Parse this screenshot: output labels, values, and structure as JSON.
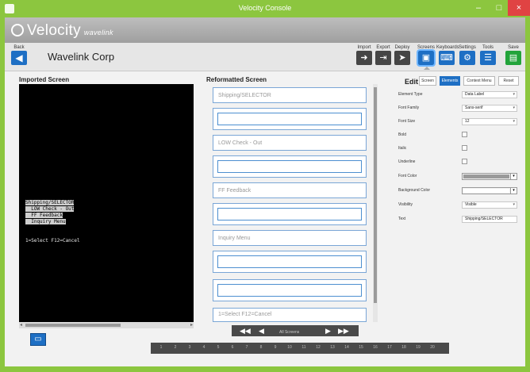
{
  "window": {
    "title": "Velocity Console",
    "controls": {
      "minimize": "–",
      "maximize": "□",
      "close": "×"
    }
  },
  "brand": {
    "name": "Velocity",
    "sub": "wavelink"
  },
  "toolbar": {
    "back_label": "Back",
    "company": "Wavelink Corp",
    "tools": [
      {
        "label": "Import",
        "icon": "import-icon",
        "style": "dark"
      },
      {
        "label": "Export",
        "icon": "export-icon",
        "style": "dark"
      },
      {
        "label": "Deploy",
        "icon": "deploy-icon",
        "style": "dark"
      },
      {
        "label": "Screens",
        "icon": "screens-icon",
        "style": "blue"
      },
      {
        "label": "Keyboards",
        "icon": "keyboard-icon",
        "style": "blue"
      },
      {
        "label": "Settings",
        "icon": "gear-icon",
        "style": "blue"
      },
      {
        "label": "Tools",
        "icon": "tools-icon",
        "style": "blue"
      },
      {
        "label": "Save",
        "icon": "save-icon",
        "style": "green"
      }
    ]
  },
  "imported": {
    "title": "Imported Screen",
    "lines": [
      "Shipping/SELECTOR",
      "  LOW Check - Out",
      "  FF Feedback",
      "  Inquiry Menu",
      "",
      "1=Select F12=Cancel"
    ]
  },
  "reformatted": {
    "title": "Reformatted Screen",
    "items": [
      "Shipping/SELECTOR",
      "",
      "LOW Check - Out",
      "",
      "FF Feedback",
      "",
      "Inquiry Menu",
      "",
      "",
      "1=Select F12=Cancel"
    ],
    "nav_label": "All Screens"
  },
  "pages": [
    "1",
    "2",
    "3",
    "4",
    "5",
    "6",
    "7",
    "8",
    "9",
    "10",
    "11",
    "12",
    "13",
    "14",
    "15",
    "16",
    "17",
    "18",
    "19",
    "20"
  ],
  "edit": {
    "title": "Edit",
    "tabs": [
      "Screen",
      "Elements",
      "Context Menu",
      "Reset"
    ],
    "active_tab": 1,
    "props": {
      "element_type": {
        "label": "Element Type",
        "value": "Data Label"
      },
      "font_family": {
        "label": "Font Family",
        "value": "Sans-serif"
      },
      "font_size": {
        "label": "Font Size",
        "value": "12"
      },
      "bold": {
        "label": "Bold"
      },
      "italic": {
        "label": "Italic"
      },
      "underline": {
        "label": "Underline"
      },
      "font_color": {
        "label": "Font Color",
        "value": "#9a9a9a"
      },
      "background_color": {
        "label": "Background Color",
        "value": "#ffffff"
      },
      "visibility": {
        "label": "Visibility",
        "value": "Visible"
      },
      "text": {
        "label": "Text",
        "value": "Shipping/SELECTOR"
      }
    }
  }
}
